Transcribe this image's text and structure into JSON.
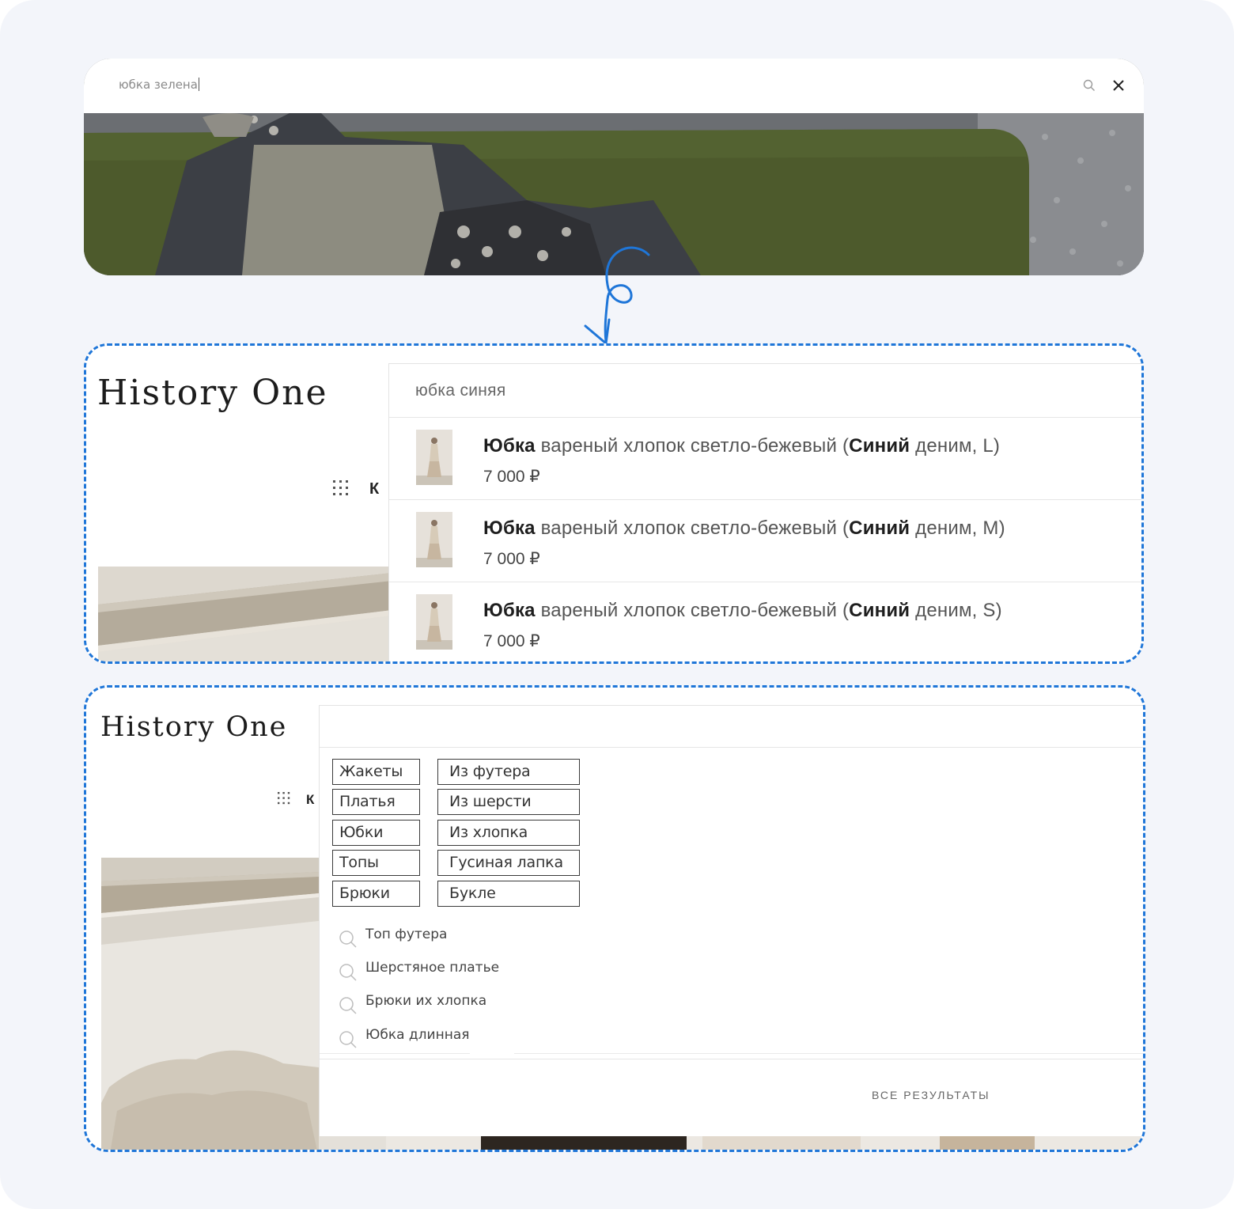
{
  "top": {
    "query": "юбка зелена",
    "search_icon": "search-icon",
    "close_icon": "close-icon"
  },
  "brand": {
    "logo": "History One"
  },
  "menu": {
    "grid_icon": "grid-icon",
    "label_cut": "К"
  },
  "search_results": {
    "query": "юбка синяя",
    "items": [
      {
        "bold_word": "Юбка",
        "text": " вареный хлопок светло-бежевый (",
        "bold_color": "Синий",
        "suffix": " деним, L)",
        "price": "7 000 ₽"
      },
      {
        "bold_word": "Юбка",
        "text": " вареный хлопок светло-бежевый (",
        "bold_color": "Синий",
        "suffix": " деним, M)",
        "price": "7 000 ₽"
      },
      {
        "bold_word": "Юбка",
        "text": " вареный хлопок светло-бежевый (",
        "bold_color": "Синий",
        "suffix": " деним, S)",
        "price": "7 000 ₽"
      }
    ]
  },
  "suggestions": {
    "categories": [
      "Жакеты",
      "Платья",
      "Юбки",
      "Топы",
      "Брюки"
    ],
    "filters": [
      "Из футера",
      "Из шерсти",
      "Из хлопка",
      "Гусиная лапка",
      "Букле"
    ],
    "queries": [
      "Топ футера",
      "Шерстяное платье",
      "Брюки их хлопка",
      "Юбка длинная"
    ],
    "all_results": "ВСЕ РЕЗУЛЬТАТЫ"
  },
  "colors": {
    "dashed_border": "#1f76d8",
    "arrow": "#1f76d8",
    "background": "#f3f5fa"
  }
}
